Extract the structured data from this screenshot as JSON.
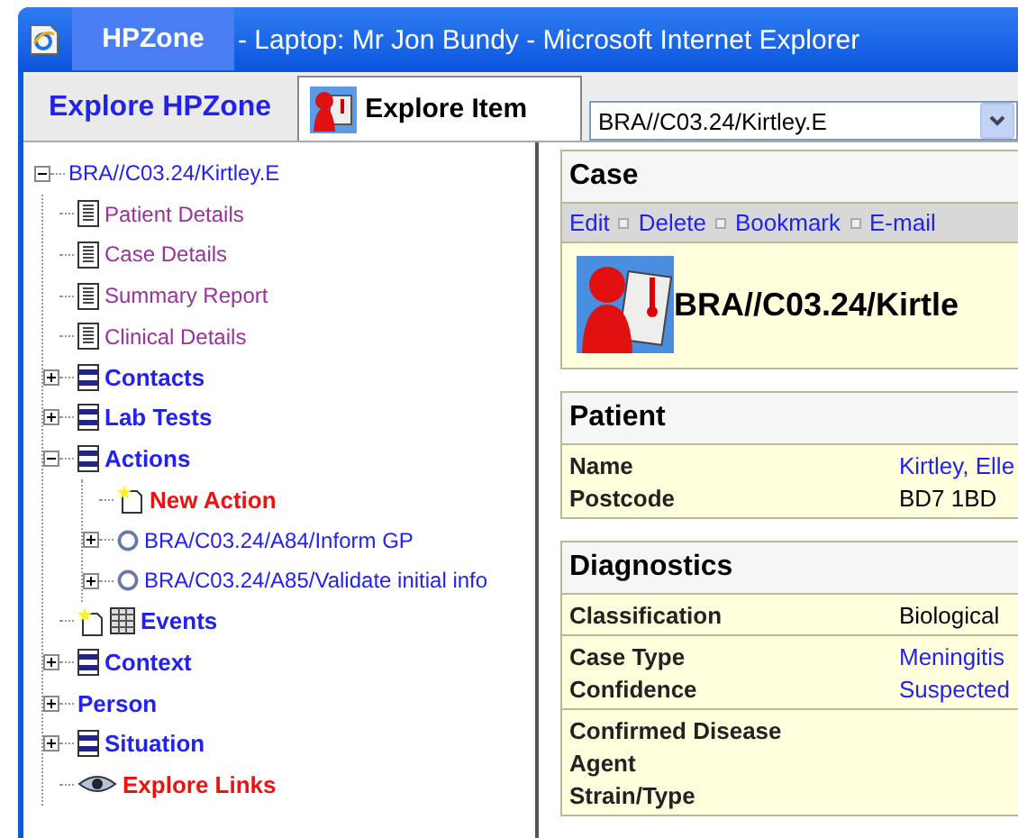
{
  "window": {
    "title": " - Laptop: Mr Jon Bundy - Microsoft Internet Explorer",
    "overlay_label": "HPZone"
  },
  "tabs": [
    {
      "label": "Explore HPZone",
      "selected": false
    },
    {
      "label": "Explore Item",
      "selected": true
    }
  ],
  "item_select": {
    "value": "BRA//C03.24/Kirtley.E"
  },
  "tree": {
    "label": "BRA//C03.24/Kirtley.E",
    "expanded": true,
    "children": [
      {
        "label": "Patient Details",
        "kind": "page"
      },
      {
        "label": "Case Details",
        "kind": "page"
      },
      {
        "label": "Summary Report",
        "kind": "page"
      },
      {
        "label": "Clinical Details",
        "kind": "page"
      },
      {
        "label": "Contacts",
        "kind": "folder",
        "expanded": false
      },
      {
        "label": "Lab Tests",
        "kind": "folder",
        "expanded": false
      },
      {
        "label": "Actions",
        "kind": "folder",
        "expanded": true,
        "children": [
          {
            "label": "New Action",
            "kind": "new"
          },
          {
            "label": "BRA/C03.24/A84/Inform GP",
            "kind": "action",
            "expanded": false
          },
          {
            "label": "BRA/C03.24/A85/Validate initial info",
            "kind": "action",
            "expanded": false
          }
        ]
      },
      {
        "label": "Events",
        "kind": "events"
      },
      {
        "label": "Context",
        "kind": "folder",
        "expanded": false
      },
      {
        "label": "Person",
        "kind": "plain",
        "expanded": false
      },
      {
        "label": "Situation",
        "kind": "folder",
        "expanded": false
      },
      {
        "label": "Explore Links",
        "kind": "links"
      }
    ]
  },
  "case": {
    "heading": "Case",
    "actions": [
      "Edit",
      "Delete",
      "Bookmark",
      "E-mail"
    ],
    "title": "BRA//C03.24/Kirtle"
  },
  "patient": {
    "heading": "Patient",
    "groups": [
      [
        {
          "label": "Name",
          "value": "Kirtley, Elle",
          "link": true
        },
        {
          "label": "Postcode",
          "value": "BD7 1BD",
          "link": false
        }
      ]
    ]
  },
  "diagnostics": {
    "heading": "Diagnostics",
    "groups": [
      [
        {
          "label": "Classification",
          "value": "Biological",
          "link": false
        }
      ],
      [
        {
          "label": "Case Type",
          "value": "Meningitis",
          "link": true
        },
        {
          "label": "Confidence",
          "value": "Suspected",
          "link": true
        }
      ],
      [
        {
          "label": "Confirmed Disease"
        },
        {
          "label": "Agent"
        },
        {
          "label": "Strain/Type"
        }
      ]
    ]
  }
}
